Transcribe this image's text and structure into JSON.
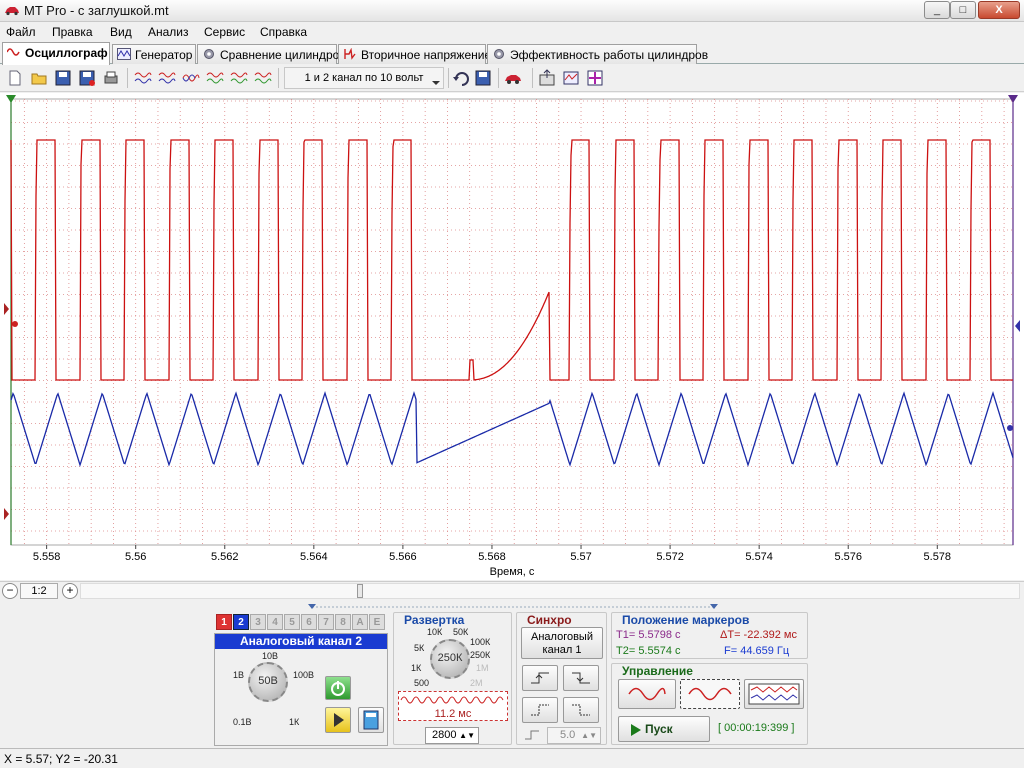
{
  "window": {
    "title": "MT Pro - с заглушкой.mt",
    "min": "_",
    "max": "□",
    "close": "X"
  },
  "menu": [
    "Файл",
    "Правка",
    "Вид",
    "Анализ",
    "Сервис",
    "Справка"
  ],
  "tabs": [
    "Осциллограф",
    "Генератор",
    "Сравнение цилиндров",
    "Вторичное напряжение",
    "Эффективность работы цилиндров"
  ],
  "toolbar": {
    "preset": "1 и 2 канал по 10 вольт"
  },
  "chart_data": {
    "type": "line",
    "xlabel": "Время, с",
    "xlim": [
      5.5572,
      5.5797
    ],
    "x_ticks": [
      "5.558",
      "5.56",
      "5.562",
      "5.564",
      "5.566",
      "5.568",
      "5.57",
      "5.572",
      "5.574",
      "5.576",
      "5.578"
    ],
    "grid": true,
    "series": [
      {
        "color": "#cc1111",
        "form": "square pulse train, high ~ +8 div, low ~ 0, dropout at 5.5663–5.5693",
        "period_s": 0.001
      },
      {
        "color": "#1a2aa8",
        "form": "triangular wave synced to channel 1, flat ramp during dropout",
        "period_s": 0.001
      }
    ]
  },
  "hscroll": {
    "ratio": "1:2"
  },
  "channel": {
    "tabs": [
      "1",
      "2",
      "3",
      "4",
      "5",
      "6",
      "7",
      "8",
      "A",
      "E"
    ],
    "name": "Аналоговый канал 2",
    "knob_value": "50В",
    "knob_labels": [
      "10В",
      "1В",
      "100В",
      "0.1В",
      "1К"
    ]
  },
  "sweep": {
    "title": "Развертка",
    "knob_value": "250К",
    "knob_labels": [
      "10К",
      "50К",
      "5К",
      "100К",
      "250К",
      "1К",
      "1М",
      "500",
      "2М"
    ],
    "time_per_div": "11.2 мс",
    "points": "2800"
  },
  "sync": {
    "title": "Синхро",
    "source": "Аналоговый канал 1",
    "level": "5.0"
  },
  "markers": {
    "title": "Положение маркеров",
    "t1": "T1= 5.5798 с",
    "t2": "T2= 5.5574 с",
    "dt": "ΔT= -22.392 мс",
    "f": "F= 44.659 Гц"
  },
  "control": {
    "title": "Управление",
    "start": "Пуск",
    "timer": "[ 00:00:19:399 ]"
  },
  "status": "X = 5.57; Y2 = -20.31"
}
